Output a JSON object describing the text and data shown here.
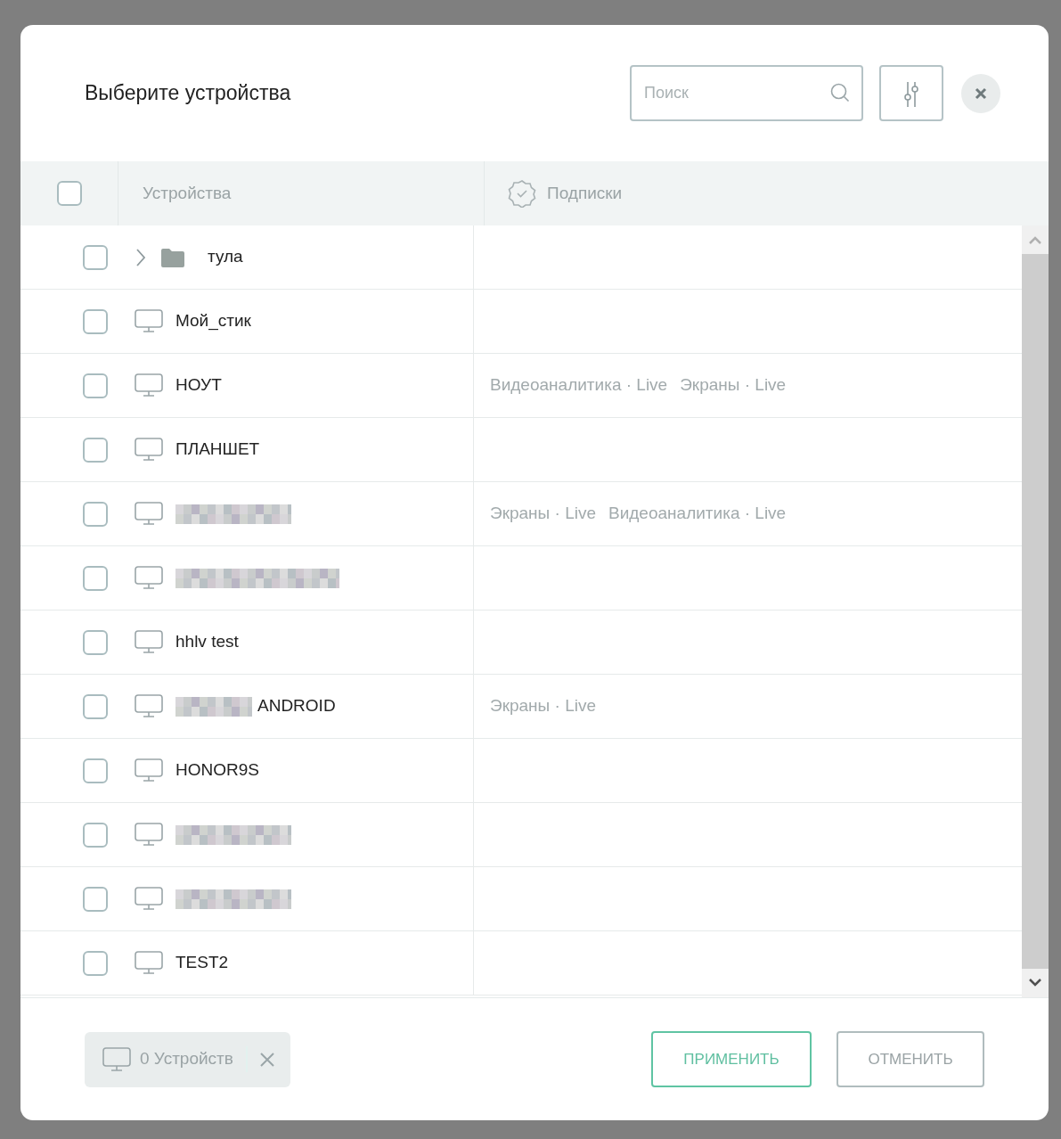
{
  "dialog": {
    "title": "Выберите устройства",
    "search": {
      "placeholder": "Поиск"
    }
  },
  "table": {
    "columns": [
      {
        "label": "Устройства"
      },
      {
        "label": "Подписки"
      }
    ],
    "header_checked": false,
    "rows": [
      {
        "kind": "folder",
        "name": "тула",
        "checked": false,
        "expanded": false,
        "subscriptions": []
      },
      {
        "kind": "device",
        "name": "Мой_стик",
        "checked": false,
        "subscriptions": []
      },
      {
        "kind": "device",
        "name": "НОУТ",
        "checked": false,
        "subscriptions": [
          "Видеоаналитика · Live",
          "Экраны · Live"
        ]
      },
      {
        "kind": "device",
        "name": "ПЛАНШЕТ",
        "checked": false,
        "subscriptions": []
      },
      {
        "kind": "redacted",
        "checked": false,
        "subscriptions": [
          "Экраны · Live",
          "Видеоаналитика · Live"
        ]
      },
      {
        "kind": "redacted",
        "checked": false,
        "subscriptions": []
      },
      {
        "kind": "device",
        "name": "hhlv test",
        "checked": false,
        "subscriptions": []
      },
      {
        "kind": "partly_redacted",
        "name": "ANDROID",
        "checked": false,
        "subscriptions": [
          "Экраны · Live"
        ]
      },
      {
        "kind": "device",
        "name": "HONOR9S",
        "checked": false,
        "subscriptions": []
      },
      {
        "kind": "redacted",
        "checked": false,
        "subscriptions": []
      },
      {
        "kind": "redacted",
        "checked": false,
        "subscriptions": []
      },
      {
        "kind": "device",
        "name": "TEST2",
        "checked": false,
        "subscriptions": []
      }
    ]
  },
  "footer": {
    "selection_chip": "0 Устройств",
    "buttons": [
      {
        "label": "ПРИМЕНИТЬ",
        "kind": "primary"
      },
      {
        "label": "ОТМЕНИТЬ",
        "kind": "secondary"
      }
    ]
  }
}
